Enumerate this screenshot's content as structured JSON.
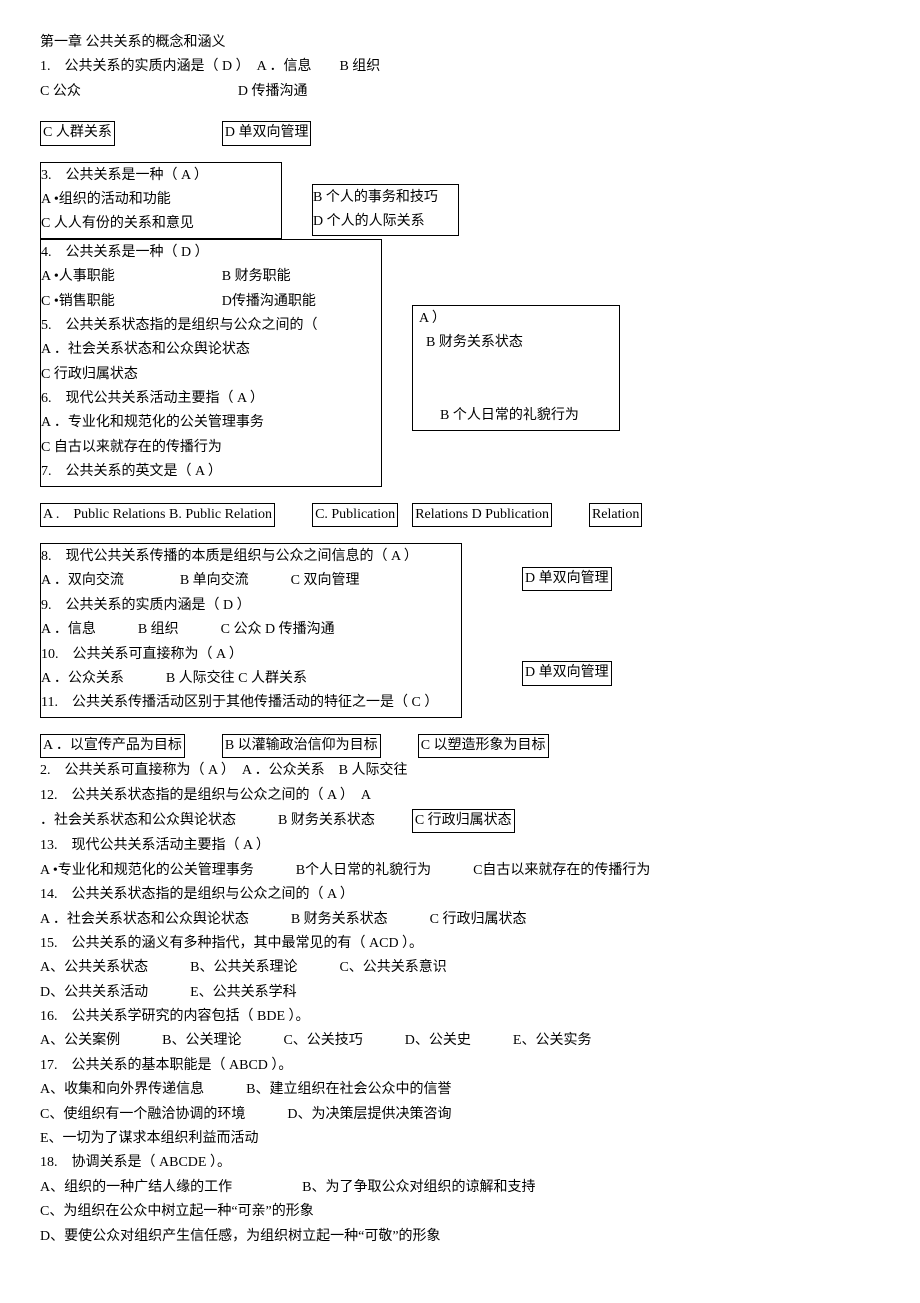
{
  "title": "第一章 公共关系的概念和涵义",
  "q1": {
    "stem": "1.　公共关系的实质内涵是（ D ）　A ．信息　　B 组织",
    "row2": "C 公众",
    "row2b": "D 传播沟通"
  },
  "row_cd": {
    "c": "C 人群关系",
    "d": "D 单双向管理"
  },
  "q3": {
    "line1": "3.　公共关系是一种（ A ）",
    "a": "A •组织的活动和功能",
    "b": "B 个人的事务和技巧",
    "c": "C 人人有份的关系和意见",
    "d": "D 个人的人际关系"
  },
  "q4": {
    "line1": "4.　公共关系是一种（ D ）",
    "row1": "A •人事职能",
    "row1b": "B 财务职能",
    "row2": "C •销售职能",
    "row2b": "D传播沟通职能"
  },
  "q5": {
    "line1": "5.　公共关系状态指的是组织与公众之间的（",
    "a_end": "A ）",
    "line2a": "A ．社会关系状态和公众舆论状态",
    "line2b": "B 财务关系状态",
    "line3": "C 行政归属状态"
  },
  "q6": {
    "line1": "6.　现代公共关系活动主要指（ A ）",
    "a": "A ．专业化和规范化的公关管理事务",
    "b": "B 个人日常的礼貌行为",
    "c": "C 自古以来就存在的传播行为"
  },
  "q7": {
    "line1": "7.　公共关系的英文是（ A ）",
    "a": "A .　Public Relations B. Public Relation",
    "c": "C. Publication",
    "rd": "Relations D Publication",
    "r": "Relation"
  },
  "q8": {
    "line1": "8.　现代公共关系传播的本质是组织与公众之间信息的（ A ）",
    "row": "A ．双向交流　　　　B 单向交流　　　C 双向管理",
    "d": "D 单双向管理"
  },
  "q9": {
    "line1": "9.　公共关系的实质内涵是（ D ）",
    "row": "A ．信息　　　B 组织　　　C 公众 D 传播沟通"
  },
  "q10": {
    "line1": "10.　公共关系可直接称为（ A ）",
    "row": "A ．公众关系　　　B 人际交往 C 人群关系",
    "d": "D 单双向管理"
  },
  "q11": {
    "line1": "11.　公共关系传播活动区别于其他传播活动的特征之一是（ C ）",
    "a": "A ．以宣传产品为目标",
    "b": "B 以灌输政治信仰为目标",
    "c": "C 以塑造形象为目标"
  },
  "q2b": "2.　公共关系可直接称为（ A ）　A ．公众关系　B 人际交往",
  "q12": {
    "line1": "12.　公共关系状态指的是组织与公众之间的（ A ）　A",
    "row": "．社会关系状态和公众舆论状态　　　B 财务关系状态",
    "c": "C 行政归属状态"
  },
  "q13": {
    "line1": "13.　现代公共关系活动主要指（ A ）",
    "row": "A •专业化和规范化的公关管理事务　　　B个人日常的礼貌行为　　　C自古以来就存在的传播行为"
  },
  "q14": {
    "line1": "14.　公共关系状态指的是组织与公众之间的（ A ）",
    "row": "A ．社会关系状态和公众舆论状态　　　B 财务关系状态　　　C 行政归属状态"
  },
  "q15": {
    "line1": "15.　公共关系的涵义有多种指代，其中最常见的有（ ACD ）。",
    "row1": "A、公共关系状态　　　B、公共关系理论　　　C、公共关系意识",
    "row2": "D、公共关系活动　　　E、公共关系学科"
  },
  "q16": {
    "line1": "16.　公共关系学研究的内容包括（ BDE ）。",
    "row": "A、公关案例　　　B、公关理论　　　C、公关技巧　　　D、公关史　　　E、公关实务"
  },
  "q17": {
    "line1": "17.　公共关系的基本职能是（ ABCD ）。",
    "row1": "A、收集和向外界传递信息　　　B、建立组织在社会公众中的信誉",
    "row2": "C、使组织有一个融洽协调的环境　　　D、为决策层提供决策咨询",
    "row3": "E、一切为了谋求本组织利益而活动"
  },
  "q18": {
    "line1": "18.　协调关系是（ ABCDE ）。",
    "row1": "A、组织的一种广结人缘的工作　　　　　B、为了争取公众对组织的谅解和支持",
    "row2": "C、为组织在公众中树立起一种“可亲”的形象",
    "row3": "D、要使公众对组织产生信任感，为组织树立起一种“可敬”的形象"
  }
}
